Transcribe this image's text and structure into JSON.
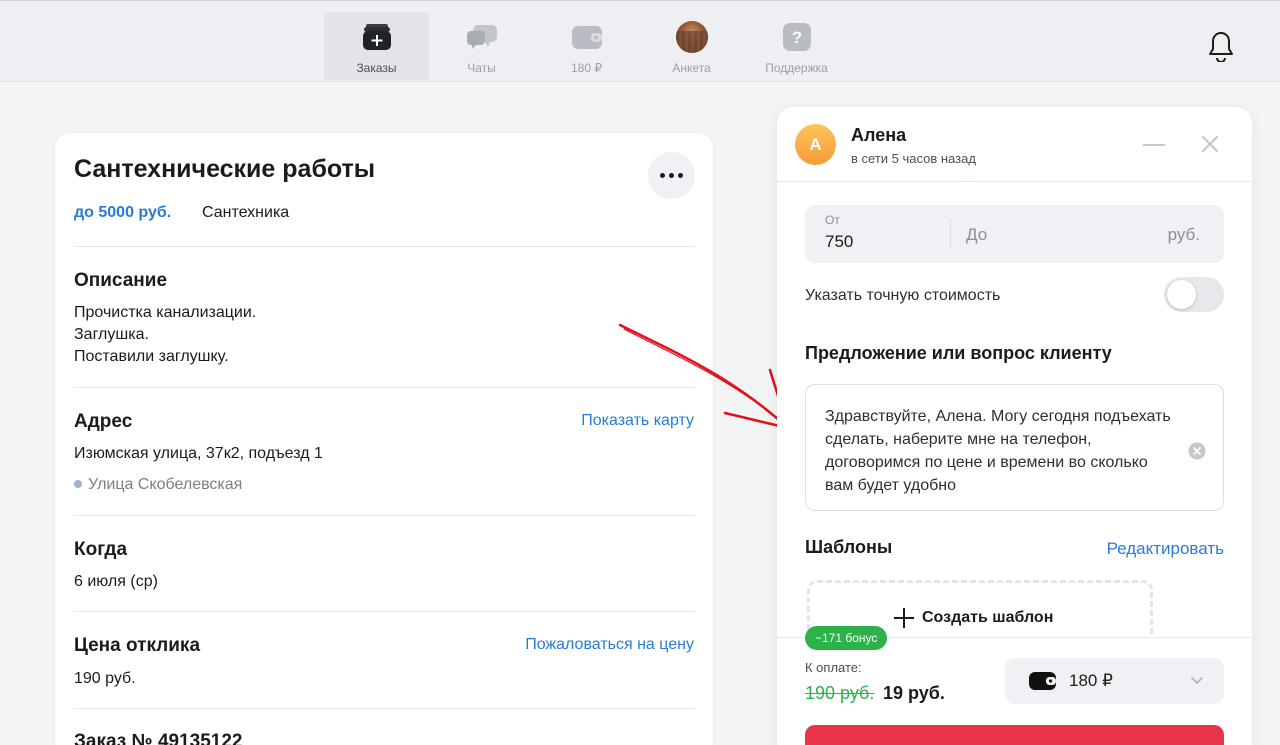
{
  "nav": {
    "items": [
      {
        "label": "Заказы",
        "icon": "orders-icon",
        "active": true
      },
      {
        "label": "Чаты",
        "icon": "chats-icon"
      },
      {
        "label": "180 ₽",
        "icon": "wallet-icon"
      },
      {
        "label": "Анкета",
        "icon": "profile-photo"
      },
      {
        "label": "Поддержка",
        "icon": "support-icon"
      }
    ],
    "support_glyph": "?",
    "bell_icon": "bell-icon"
  },
  "order": {
    "title": "Сантехнические работы",
    "budget": "до 5000 руб.",
    "category": "Сантехника",
    "description": {
      "heading": "Описание",
      "lines": [
        "Прочистка канализации.",
        "Заглушка.",
        "Поставили заглушку."
      ]
    },
    "address": {
      "heading": "Адрес",
      "map_link": "Показать карту",
      "value": "Изюмская улица, 37к2, подъезд 1",
      "metro": "Улица Скобелевская"
    },
    "when": {
      "heading": "Когда",
      "value": "6 июля (ср)"
    },
    "price": {
      "heading": "Цена отклика",
      "complain_link": "Пожаловаться на цену",
      "value": "190 руб."
    },
    "order_number": "Заказ № 49135122"
  },
  "panel": {
    "client": {
      "initial": "А",
      "name": "Алена",
      "status": "в сети 5 часов назад"
    },
    "price": {
      "from_label": "От",
      "from_value": "750",
      "to_placeholder": "До",
      "currency": "руб."
    },
    "exact_price_label": "Указать точную стоимость",
    "exact_price_enabled": false,
    "offer": {
      "heading": "Предложение или вопрос клиенту",
      "text": "Здравствуйте, Алена. Могу сегодня подъехать сделать, наберите мне на телефон, договоримся по цене и времени во сколько вам будет удобно"
    },
    "templates": {
      "heading": "Шаблоны",
      "edit_link": "Редактировать",
      "create_label": "Создать шаблон"
    },
    "payment": {
      "bonus_badge": "−171 бонус",
      "label": "К оплате:",
      "old_price": "190 руб.",
      "new_price": "19 руб.",
      "wallet_value": "180 ₽"
    }
  },
  "colors": {
    "accent": "#2a7bd6",
    "success": "#2bb34a",
    "danger": "#e8344a",
    "avatar": "#f59b3a",
    "annotation_arrow": "#e3101a"
  }
}
